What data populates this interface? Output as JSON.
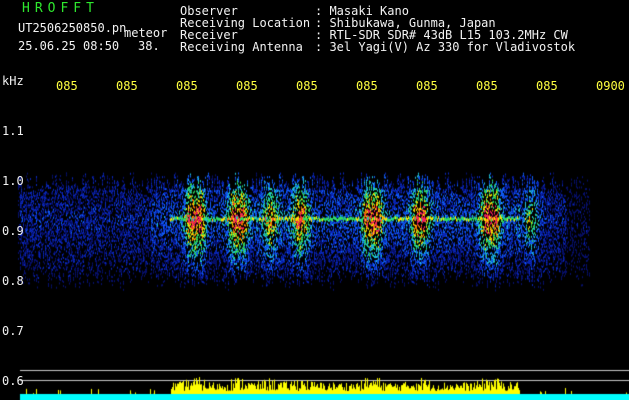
{
  "header": {
    "title": "HROFFT",
    "filename": "UT2506250850.pn",
    "mode": "meteor",
    "datetime": "25.06.25 08:50",
    "count": "38."
  },
  "info": [
    {
      "label": "Observer",
      "value": ": Masaki Kano"
    },
    {
      "label": "Receiving Location",
      "value": ": Shibukawa, Gunma, Japan"
    },
    {
      "label": "Receiver",
      "value": ": RTL-SDR SDR# 43dB L15 103.2MHz CW"
    },
    {
      "label": "Receiving Antenna",
      "value": ": 3el Yagi(V) Az 330 for Vladivostok"
    }
  ],
  "axis": {
    "unit": "kHz",
    "y_ticks": [
      "1.1",
      "1.0",
      "0.9",
      "0.8",
      "0.7",
      "0.6"
    ],
    "x_ticks": [
      "085",
      "085",
      "085",
      "085",
      "085",
      "085",
      "085",
      "085",
      "085",
      "0900"
    ]
  },
  "colors": {
    "background": "#000000",
    "text": "#f2f2f2",
    "time_labels": "#ffff40",
    "title": "#2ee82e",
    "low_signal": "#0a1a9a",
    "mid_signal": "#20c8e0",
    "high_signal": "#ffe800",
    "peak_signal": "#ff2060",
    "level_bars": "#ffff00",
    "level_base": "#00ffff"
  }
}
